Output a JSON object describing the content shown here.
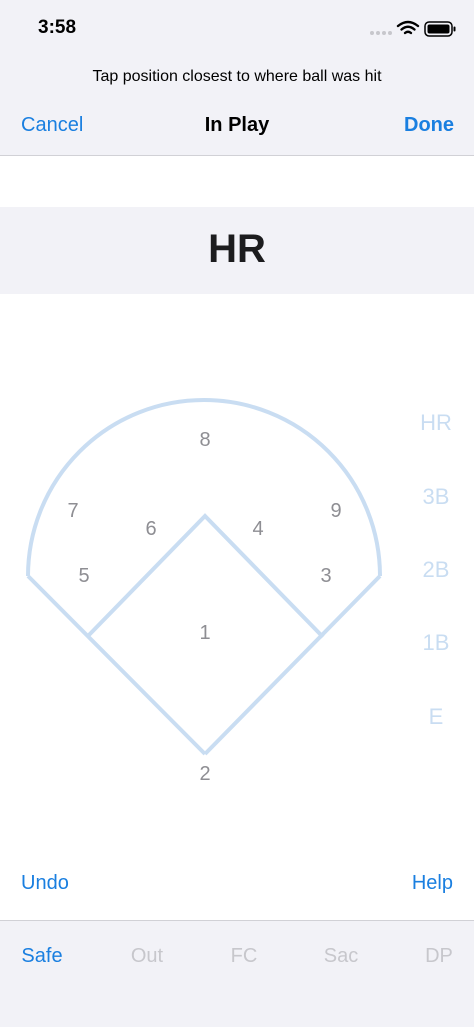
{
  "status_bar": {
    "time": "3:58"
  },
  "header": {
    "prompt": "Tap position closest to where ball was hit",
    "cancel_label": "Cancel",
    "title": "In Play",
    "done_label": "Done"
  },
  "result": {
    "label": "HR"
  },
  "field": {
    "positions": [
      "1",
      "2",
      "3",
      "4",
      "5",
      "6",
      "7",
      "8",
      "9"
    ],
    "line_color": "#c9ddf2",
    "label_color": "#8e8e93"
  },
  "hit_types": [
    "HR",
    "3B",
    "2B",
    "1B",
    "E"
  ],
  "actions": {
    "undo_label": "Undo",
    "help_label": "Help"
  },
  "tabs": [
    {
      "label": "Safe",
      "active": true
    },
    {
      "label": "Out",
      "active": false
    },
    {
      "label": "FC",
      "active": false
    },
    {
      "label": "Sac",
      "active": false
    },
    {
      "label": "DP",
      "active": false
    }
  ],
  "colors": {
    "accent": "#1a7fe0",
    "inactive": "#c7c7cc",
    "bar_bg": "#f2f2f7"
  }
}
